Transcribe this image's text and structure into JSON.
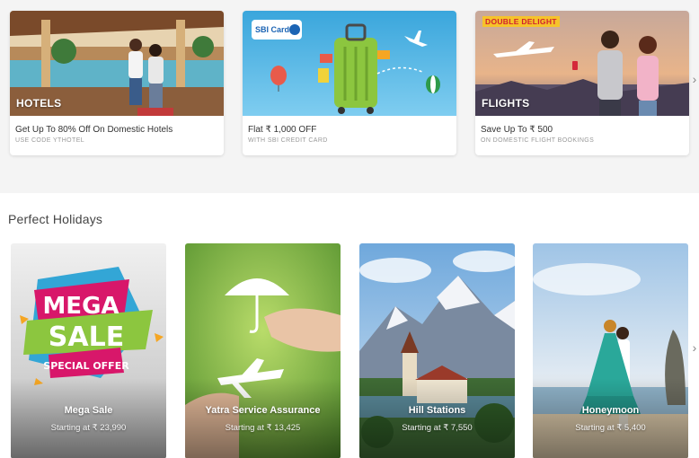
{
  "offers": [
    {
      "label": "HOTELS",
      "title": "Get Up To 80% Off On Domestic Hotels",
      "subtitle": "USE CODE YTHOTEL"
    },
    {
      "label": "",
      "brand": "SBI Card",
      "title": "Flat ₹ 1,000 OFF",
      "subtitle": "WITH SBI CREDIT CARD"
    },
    {
      "label": "FLIGHTS",
      "badge": "DOUBLE DELIGHT",
      "title": "Save Up To ₹ 500",
      "subtitle": "ON DOMESTIC FLIGHT BOOKINGS"
    }
  ],
  "holidays": {
    "title": "Perfect Holidays",
    "items": [
      {
        "name": "Mega Sale",
        "price": "Starting at ₹ 23,990",
        "art": [
          "MEGA",
          "SALE",
          "SPECIAL OFFER"
        ]
      },
      {
        "name": "Yatra Service Assurance",
        "price": "Starting at ₹ 13,425"
      },
      {
        "name": "Hill Stations",
        "price": "Starting at ₹ 7,550"
      },
      {
        "name": "Honeymoon",
        "price": "Starting at ₹ 5,400"
      }
    ]
  },
  "icons": {
    "next": "chevron-right-icon"
  }
}
